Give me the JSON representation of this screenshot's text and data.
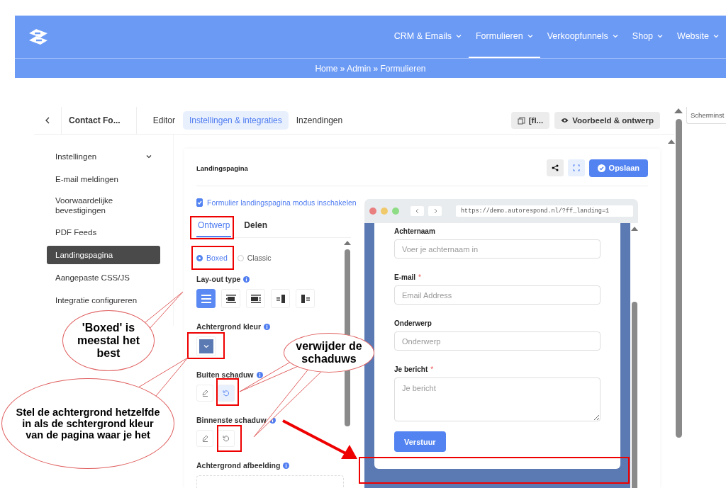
{
  "header": {
    "nav": [
      {
        "label": "CRM & Emails",
        "selected": false
      },
      {
        "label": "Formulieren",
        "selected": true
      },
      {
        "label": "Verkoopfunnels",
        "selected": false
      },
      {
        "label": "Shop",
        "selected": false
      },
      {
        "label": "Website",
        "selected": false
      }
    ],
    "breadcrumb": "Home » Admin » Formulieren"
  },
  "topbar": {
    "form_title": "Contact Fo...",
    "tabs": [
      {
        "label": "Editor",
        "selected": false
      },
      {
        "label": "Instellingen & integraties",
        "selected": true
      },
      {
        "label": "Inzendingen",
        "selected": false
      }
    ],
    "shortcode_button": "[fl...",
    "preview_button": "Voorbeeld & ontwerp"
  },
  "side_panel": {
    "tab": "Scherminst"
  },
  "sidebar": {
    "items": [
      {
        "label": "Instellingen",
        "selected": false,
        "kind": "group"
      },
      {
        "label": "E-mail meldingen",
        "selected": false,
        "kind": "link"
      },
      {
        "label": "Voorwaardelijke bevestigingen",
        "selected": false,
        "kind": "link"
      },
      {
        "label": "PDF Feeds",
        "selected": false,
        "kind": "link"
      },
      {
        "label": "Landingspagina",
        "selected": true,
        "kind": "link"
      },
      {
        "label": "Aangepaste CSS/JS",
        "selected": false,
        "kind": "link"
      },
      {
        "label": "Integratie configureren",
        "selected": false,
        "kind": "link"
      }
    ]
  },
  "settings": {
    "title": "Landingspagina",
    "save_button": "Opslaan",
    "enable": {
      "label": "Formulier landingspagina modus inschakelen",
      "checked": true
    },
    "tabs": [
      {
        "label": "Ontwerp",
        "selected": true
      },
      {
        "label": "Delen",
        "selected": false
      }
    ],
    "layout_mode": [
      {
        "label": "Boxed",
        "selected": true
      },
      {
        "label": "Classic",
        "selected": false
      }
    ],
    "layout_type": {
      "label": "Lay-out type",
      "options": [
        {
          "kind": "full",
          "selected": true
        },
        {
          "kind": "center",
          "selected": false
        },
        {
          "kind": "media-left",
          "selected": false
        },
        {
          "kind": "split-right",
          "selected": false
        },
        {
          "kind": "split-left",
          "selected": false
        }
      ]
    },
    "background_color": {
      "label": "Achtergrond kleur"
    },
    "outer_shadow": {
      "label": "Buiten schaduw"
    },
    "inner_shadow": {
      "label": "Binnenste schaduw"
    },
    "background_image": {
      "label": "Achtergrond afbeelding"
    }
  },
  "preview": {
    "url": "https://demo.autorespond.nl/?ff_landing=1",
    "fields": [
      {
        "label": "Achternaam",
        "required": false,
        "placeholder": "Voer je achternaam in",
        "kind": "input"
      },
      {
        "label": "E-mail",
        "required": true,
        "placeholder": "Email Address",
        "kind": "input"
      },
      {
        "label": "Onderwerp",
        "required": false,
        "placeholder": "Onderwerp",
        "kind": "input"
      },
      {
        "label": "Je bericht",
        "required": true,
        "placeholder": "Je bericht",
        "kind": "textarea"
      }
    ],
    "required_marker": "*",
    "submit": "Verstuur"
  },
  "annotations": {
    "callouts": [
      "'Boxed' is meestal het best",
      "Stel de achtergrond hetzelfde in als de schtergrond kleur van de pagina waar je het",
      "verwijder de schaduws"
    ]
  }
}
